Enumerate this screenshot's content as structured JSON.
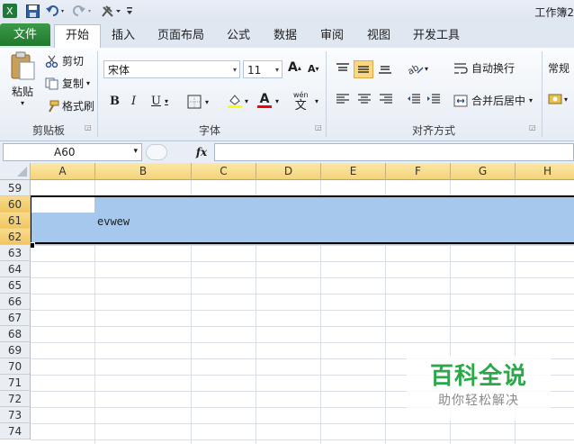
{
  "window": {
    "title": "工作簿2"
  },
  "quick_access": {
    "icons": [
      "excel-logo-icon",
      "save-icon",
      "undo-icon",
      "redo-icon",
      "tools-icon",
      "customize-icon"
    ]
  },
  "tabs": [
    "文件",
    "开始",
    "插入",
    "页面布局",
    "公式",
    "数据",
    "审阅",
    "视图",
    "开发工具"
  ],
  "clipboard": {
    "paste": "粘贴",
    "cut": "剪切",
    "copy": "复制",
    "format_painter": "格式刷",
    "group": "剪贴板"
  },
  "font": {
    "name": "宋体",
    "size": "11",
    "bold": "B",
    "italic": "I",
    "underline": "U",
    "wen": "wén",
    "wen_char": "文",
    "group": "字体",
    "a_big": "A",
    "a_small": "A",
    "font_color_letter": "A"
  },
  "alignment": {
    "wrap": "自动换行",
    "merge": "合并后居中",
    "group": "对齐方式"
  },
  "number": {
    "format": "常规"
  },
  "formula_bar": {
    "name_box": "A60",
    "fx": "fx",
    "value": ""
  },
  "columns": [
    "A",
    "B",
    "C",
    "D",
    "E",
    "F",
    "G",
    "H"
  ],
  "rows": [
    "59",
    "60",
    "61",
    "62",
    "63",
    "64",
    "65",
    "66",
    "67",
    "68",
    "69",
    "70",
    "71",
    "72",
    "73",
    "74"
  ],
  "cells": {
    "B61": "evwew"
  },
  "watermark": {
    "title": "百科全说",
    "subtitle": "助你轻松解决"
  },
  "colors": {
    "file_tab": "#2a8a3a",
    "selection": "#a6c8ec",
    "header_selected": "#f4d37b",
    "watermark": "#2aa84a"
  }
}
